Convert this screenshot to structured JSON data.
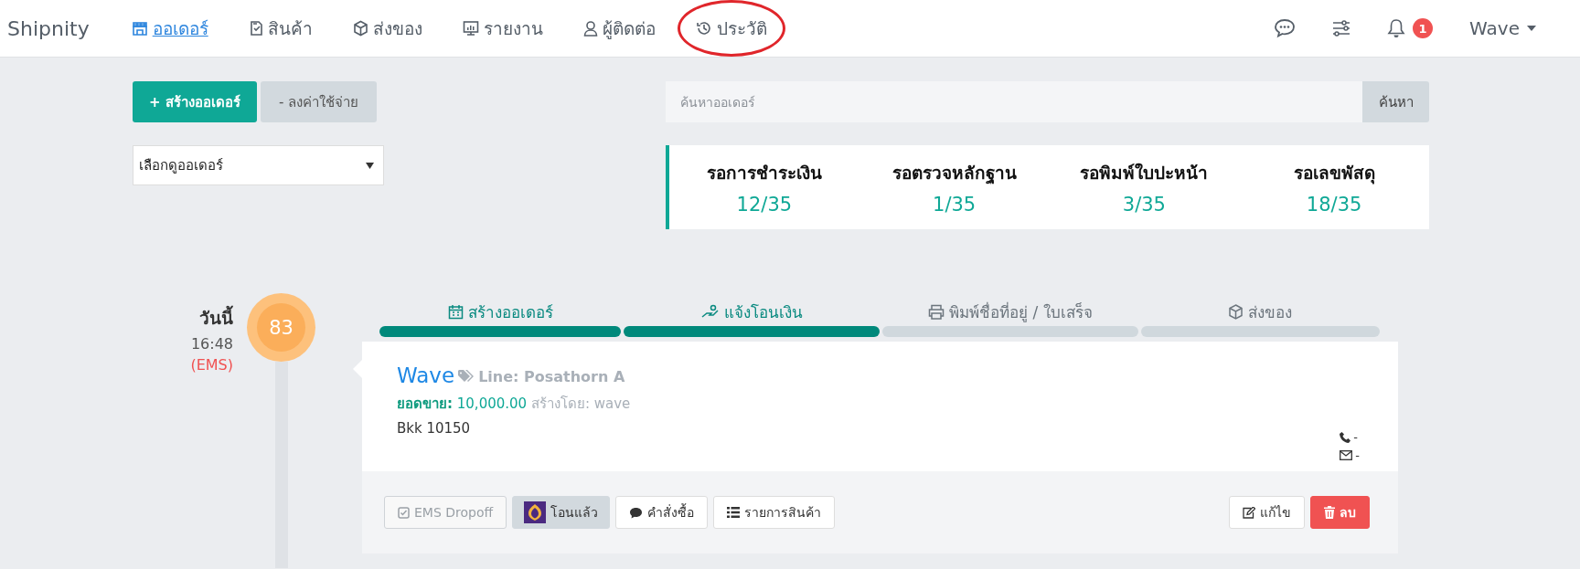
{
  "navbar": {
    "brand": "Shipnity",
    "items": [
      {
        "label": "ออเดอร์",
        "selected": true,
        "circled": false
      },
      {
        "label": "สินค้า",
        "selected": false,
        "circled": false
      },
      {
        "label": "ส่งของ",
        "selected": false,
        "circled": false
      },
      {
        "label": "รายงาน",
        "selected": false,
        "circled": false
      },
      {
        "label": "ผู้ติดต่อ",
        "selected": false,
        "circled": false
      },
      {
        "label": "ประวัติ",
        "selected": false,
        "circled": true
      }
    ],
    "notification_count": "1",
    "user": "Wave"
  },
  "actions": {
    "create": "+ สร้างออเดอร์",
    "expense": "- ลงค่าใช้จ่าย"
  },
  "search": {
    "placeholder": "ค้นหาออเดอร์",
    "button": "ค้นหา"
  },
  "filter": {
    "value": "เลือกดูออเดอร์"
  },
  "stats": [
    {
      "label": "รอการชำระเงิน",
      "value": "12/35"
    },
    {
      "label": "รอตรวจหลักฐาน",
      "value": "1/35"
    },
    {
      "label": "รอพิมพ์ใบปะหน้า",
      "value": "3/35"
    },
    {
      "label": "รอเลขพัสดุ",
      "value": "18/35"
    }
  ],
  "order": {
    "day": "วันนี้",
    "time": "16:48",
    "carrier": "(EMS)",
    "number": "83",
    "steps": [
      {
        "label": "สร้างออเดอร์",
        "done": true
      },
      {
        "label": "แจ้งโอนเงิน",
        "done": true
      },
      {
        "label": "พิมพ์ชื่อที่อยู่ / ใบเสร็จ",
        "done": false
      },
      {
        "label": "ส่งของ",
        "done": false
      }
    ],
    "customer": "Wave",
    "channel": "Line: Posathorn A",
    "sales_label": "ยอดขาย:",
    "sales": "10,000.00",
    "creator": "สร้างโดย: wave",
    "address": "Bkk 10150",
    "phone": "-",
    "email": "-",
    "buttons": [
      {
        "label": "EMS Dropoff",
        "kind": "check",
        "disabled": true
      },
      {
        "label": "โอนแล้ว",
        "kind": "bank",
        "disabled": false
      },
      {
        "label": "คำสั่งซื้อ",
        "kind": "comment",
        "disabled": false
      },
      {
        "label": "รายการสินค้า",
        "kind": "list",
        "disabled": false
      }
    ],
    "edit": "แก้ไข",
    "delete": "ลบ"
  }
}
